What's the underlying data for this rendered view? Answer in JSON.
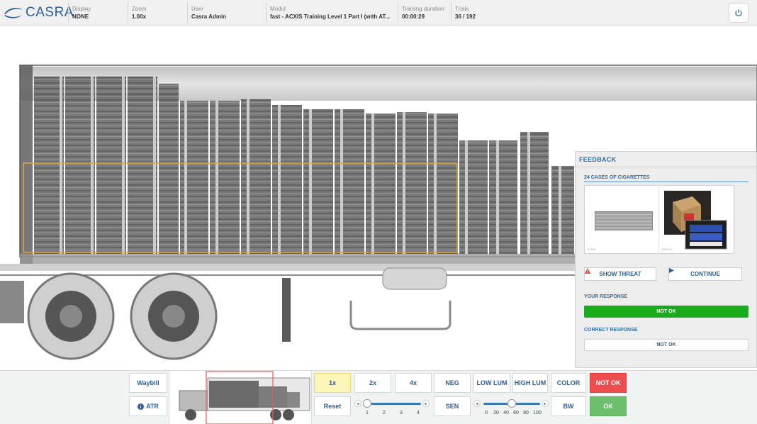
{
  "header": {
    "logo_text": "CASRA",
    "display": {
      "label": "Display",
      "value": "NONE"
    },
    "zoom": {
      "label": "Zoom",
      "value": "1.00x"
    },
    "user": {
      "label": "User",
      "value": "Casra Admin"
    },
    "modul": {
      "label": "Modul",
      "value": "fast - ACXIS Training Level 1 Part I (with AT..."
    },
    "duration": {
      "label": "Training duration",
      "value": "00:00:29"
    },
    "trials": {
      "label": "Trials",
      "value": "36 / 192"
    }
  },
  "feedback": {
    "title": "FEEDBACK",
    "threat_name": "24 CASES OF CIGARETTES",
    "xray_caption": "X-RAY",
    "photo_caption": "PHOTO",
    "show_threat_label": "SHOW THREAT",
    "continue_label": "CONTINUE",
    "your_response_label": "YOUR RESPONSE",
    "your_response_value": "NOT OK",
    "correct_response_label": "CORRECT RESPONSE",
    "correct_response_value": "NOT OK"
  },
  "toolbar": {
    "waybill_label": "Waybill",
    "atr_label": "ATR",
    "zoom_1x": "1x",
    "zoom_2x": "2x",
    "zoom_4x": "4x",
    "reset_label": "Reset",
    "zoom_ticks": [
      "1",
      "2",
      "3",
      "4"
    ],
    "zoom_slider_value": 1,
    "neg_label": "NEG",
    "sen_label": "SEN",
    "low_lum_label": "LOW LUM",
    "high_lum_label": "HIGH LUM",
    "lum_ticks": [
      "0",
      "20",
      "40",
      "60",
      "80",
      "100"
    ],
    "lum_slider_value": 50,
    "color_label": "COLOR",
    "bw_label": "BW",
    "not_ok_label": "NOT OK",
    "ok_label": "OK"
  },
  "colors": {
    "brand_blue": "#2f5f95",
    "accent_blue": "#2f6ea4",
    "success_green": "#1aab1a",
    "ok_green": "#6dbf6d",
    "not_ok_red": "#ee4d4d",
    "selected_yellow": "#fbf5b8",
    "threat_box_orange": "#e8a33a"
  },
  "icons": {
    "logo": "casra-swoosh-icon",
    "power": "power-icon",
    "warning": "warning-triangle-icon",
    "play": "play-icon",
    "info": "info-icon"
  }
}
